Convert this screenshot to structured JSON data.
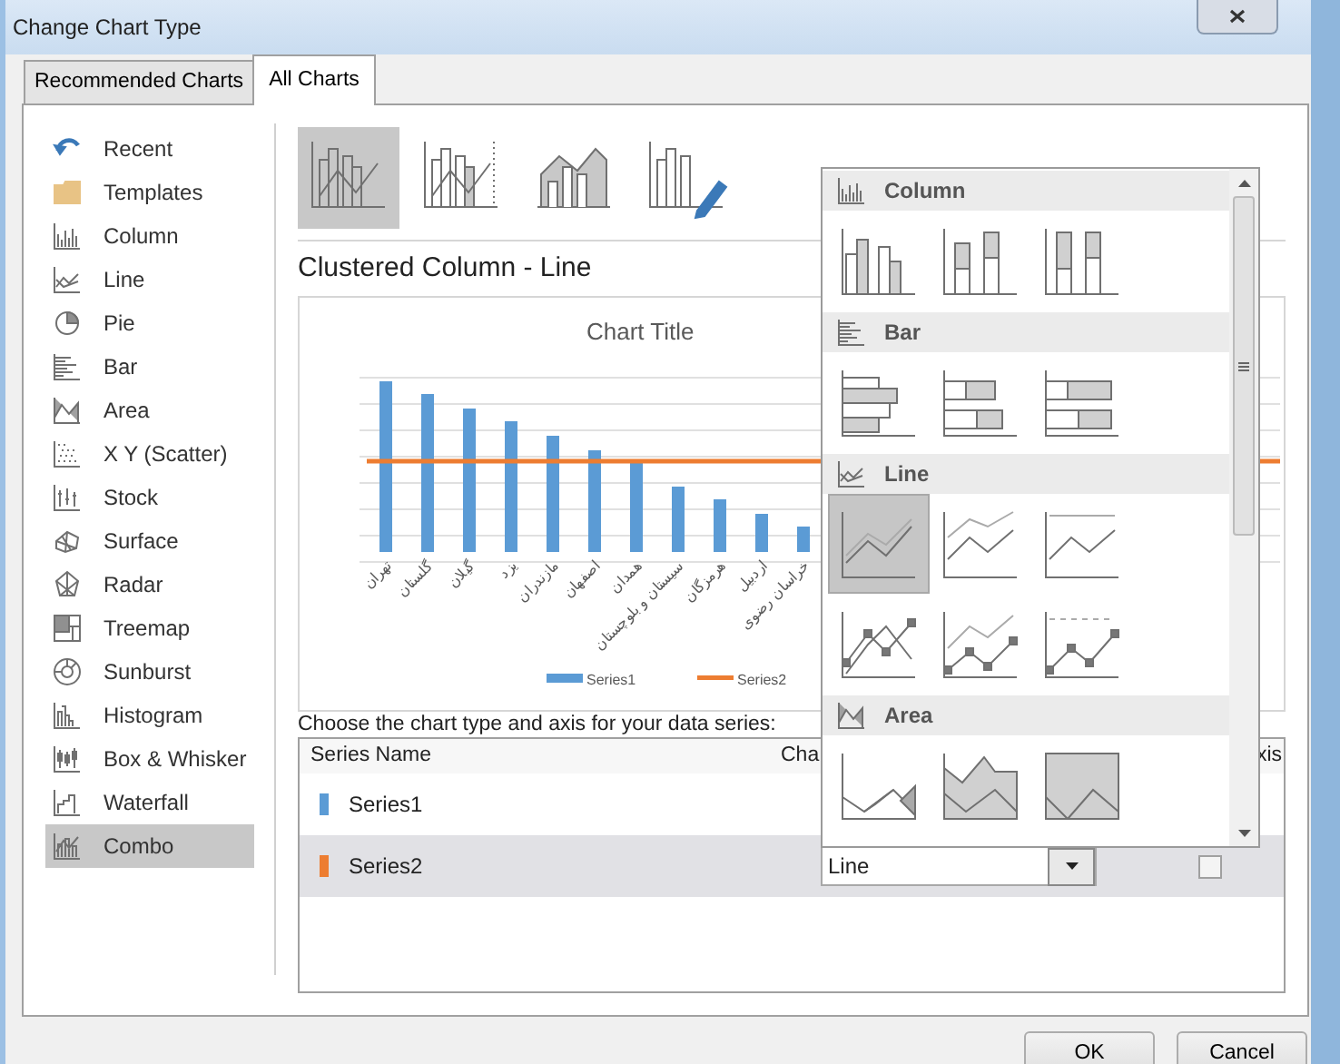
{
  "window": {
    "title": "Change Chart Type"
  },
  "tabs": [
    {
      "label": "Recommended Charts",
      "selected": false
    },
    {
      "label": "All Charts",
      "selected": true
    }
  ],
  "sidebar": {
    "items": [
      {
        "label": "Recent",
        "selected": false
      },
      {
        "label": "Templates",
        "selected": false
      },
      {
        "label": "Column",
        "selected": false
      },
      {
        "label": "Line",
        "selected": false
      },
      {
        "label": "Pie",
        "selected": false
      },
      {
        "label": "Bar",
        "selected": false
      },
      {
        "label": "Area",
        "selected": false
      },
      {
        "label": "X Y (Scatter)",
        "selected": false
      },
      {
        "label": "Stock",
        "selected": false
      },
      {
        "label": "Surface",
        "selected": false
      },
      {
        "label": "Radar",
        "selected": false
      },
      {
        "label": "Treemap",
        "selected": false
      },
      {
        "label": "Sunburst",
        "selected": false
      },
      {
        "label": "Histogram",
        "selected": false
      },
      {
        "label": "Box & Whisker",
        "selected": false
      },
      {
        "label": "Waterfall",
        "selected": false
      },
      {
        "label": "Combo",
        "selected": true
      }
    ]
  },
  "combo_styles": [
    {
      "selected": true
    },
    {
      "selected": false
    },
    {
      "selected": false
    },
    {
      "selected": false
    }
  ],
  "subtitle": "Clustered Column - Line",
  "chart": {
    "title": "Chart Title",
    "categories": [
      "تهران",
      "گلستان",
      "گیلان",
      "یزد",
      "مازندران",
      "اصفهان",
      "همدان",
      "سیستان و بلوچستان",
      "هرمزگان",
      "اردبیل",
      "خراسان رضوی"
    ],
    "legend": [
      {
        "name": "Series1",
        "color": "#5b9bd5"
      },
      {
        "name": "Series2",
        "color": "#ed7d31"
      }
    ]
  },
  "instruction": "Choose the chart type and axis for your data series:",
  "series_table": {
    "columns": [
      "Series Name",
      "Cha",
      "xis"
    ],
    "rows": [
      {
        "name": "Series1",
        "color": "#5b9bd5",
        "selected": false
      },
      {
        "name": "Series2",
        "color": "#ed7d31",
        "selected": true,
        "chart_type": "Line",
        "secondary_axis": false
      }
    ]
  },
  "dropdown": {
    "groups": [
      {
        "label": "Column",
        "options": [
          {
            "selected": false
          },
          {
            "selected": false
          },
          {
            "selected": false
          }
        ]
      },
      {
        "label": "Bar",
        "options": [
          {
            "selected": false
          },
          {
            "selected": false
          },
          {
            "selected": false
          }
        ]
      },
      {
        "label": "Line",
        "options": [
          {
            "selected": true
          },
          {
            "selected": false
          },
          {
            "selected": false
          },
          {
            "selected": false
          },
          {
            "selected": false
          },
          {
            "selected": false
          }
        ]
      },
      {
        "label": "Area",
        "options": [
          {
            "selected": false
          },
          {
            "selected": false
          },
          {
            "selected": false
          }
        ]
      }
    ]
  },
  "buttons": [
    "OK",
    "Cancel"
  ]
}
